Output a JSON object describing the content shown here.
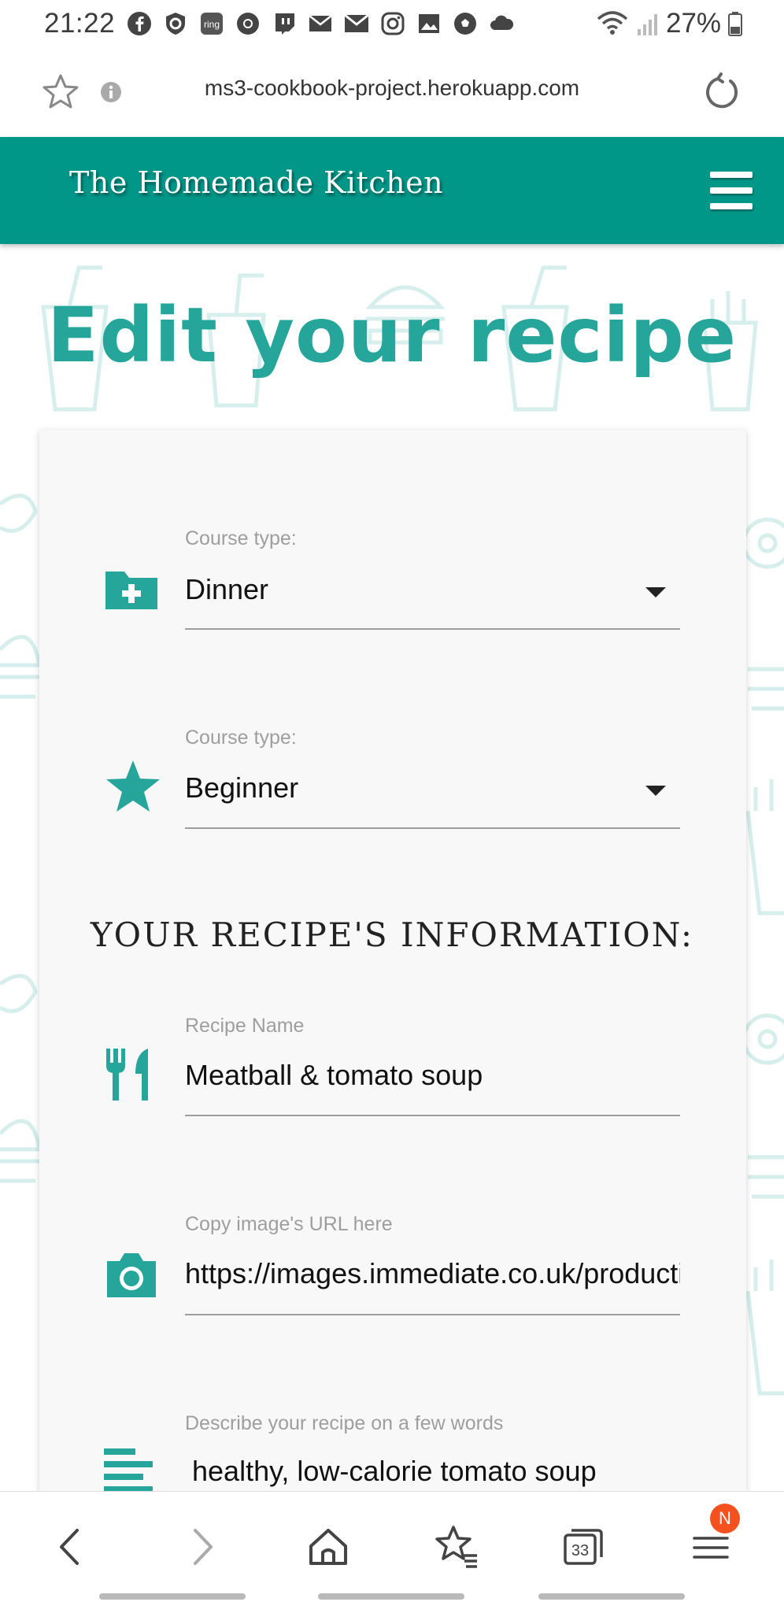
{
  "status_bar": {
    "time": "21:22",
    "battery": "27%",
    "icons": [
      "facebook-icon",
      "shield-icon",
      "ring-icon",
      "chrome-icon",
      "twitch-icon",
      "mail-icon",
      "gmail-icon",
      "instagram-icon",
      "gallery-icon",
      "football-icon",
      "cloud-icon"
    ]
  },
  "browser": {
    "url": "ms3-cookbook-project.herokuapp.com",
    "tab_count": "33",
    "notification_badge": "N"
  },
  "app": {
    "brand": "The Homemade Kitchen",
    "accent_color": "#009688",
    "title_color": "#26a69a"
  },
  "page": {
    "title": "Edit your recipe"
  },
  "form": {
    "course": {
      "label": "Course type:",
      "value": "Dinner"
    },
    "difficulty": {
      "label": "Course type:",
      "value": "Beginner"
    },
    "section_heading": "YOUR RECIPE'S INFORMATION:",
    "recipe_name": {
      "label": "Recipe Name",
      "value": "Meatball & tomato soup"
    },
    "image_url": {
      "label": "Copy image's URL here",
      "value": "https://images.immediate.co.uk/production"
    },
    "description": {
      "label": "Describe your recipe on a few words",
      "value": "healthy, low-calorie tomato soup"
    }
  }
}
